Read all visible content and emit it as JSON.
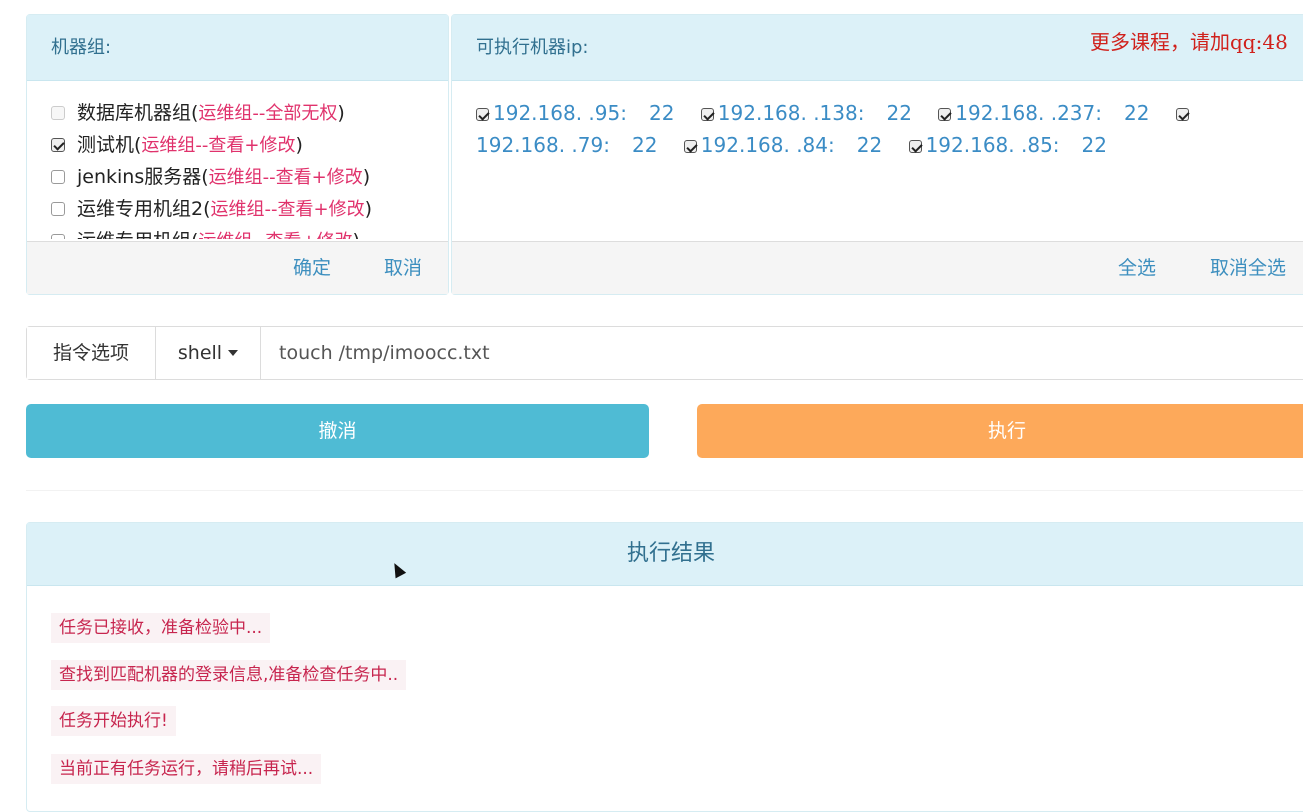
{
  "groups_panel": {
    "title": "机器组:",
    "items": [
      {
        "name": "数据库机器组(",
        "perm": "运维组--全部无权",
        "close": ")",
        "state": "disabled"
      },
      {
        "name": "测试机(",
        "perm": "运维组--查看+修改",
        "close": ")",
        "state": "checked"
      },
      {
        "name": "jenkins服务器(",
        "perm": "运维组--查看+修改",
        "close": ")",
        "state": "unchecked"
      },
      {
        "name": "运维专用机组2(",
        "perm": "运维组--查看+修改",
        "close": ")",
        "state": "unchecked"
      },
      {
        "name": "运维专用机组(",
        "perm": "运维组--查看+修改",
        "close": ")",
        "state": "unchecked"
      }
    ],
    "confirm_label": "确定",
    "cancel_label": "取消"
  },
  "ip_panel": {
    "title": "可执行机器ip:",
    "watermark": "更多课程，请加qq:48",
    "ips": [
      {
        "addr": "192.168.  .95:",
        "port": "22"
      },
      {
        "addr": "192.168.  .138:",
        "port": "22"
      },
      {
        "addr": "192.168.  .237:",
        "port": "22"
      },
      {
        "addr": "192.168.  .79:",
        "port": "22"
      },
      {
        "addr": "192.168.  .84:",
        "port": "22"
      },
      {
        "addr": "192.168.  .85:",
        "port": "22"
      }
    ],
    "select_all_label": "全选",
    "deselect_all_label": "取消全选"
  },
  "command": {
    "option_label": "指令选项",
    "type_selected": "shell",
    "value": "touch /tmp/imoocc.txt"
  },
  "actions": {
    "cancel_label": "撤消",
    "run_label": "执行"
  },
  "result": {
    "title": "执行结果",
    "lines": [
      "任务已接收，准备检验中...",
      "查找到匹配机器的登录信息,准备检查任务中..",
      "任务开始执行!",
      "当前正有任务运行，请稍后再试..."
    ]
  }
}
